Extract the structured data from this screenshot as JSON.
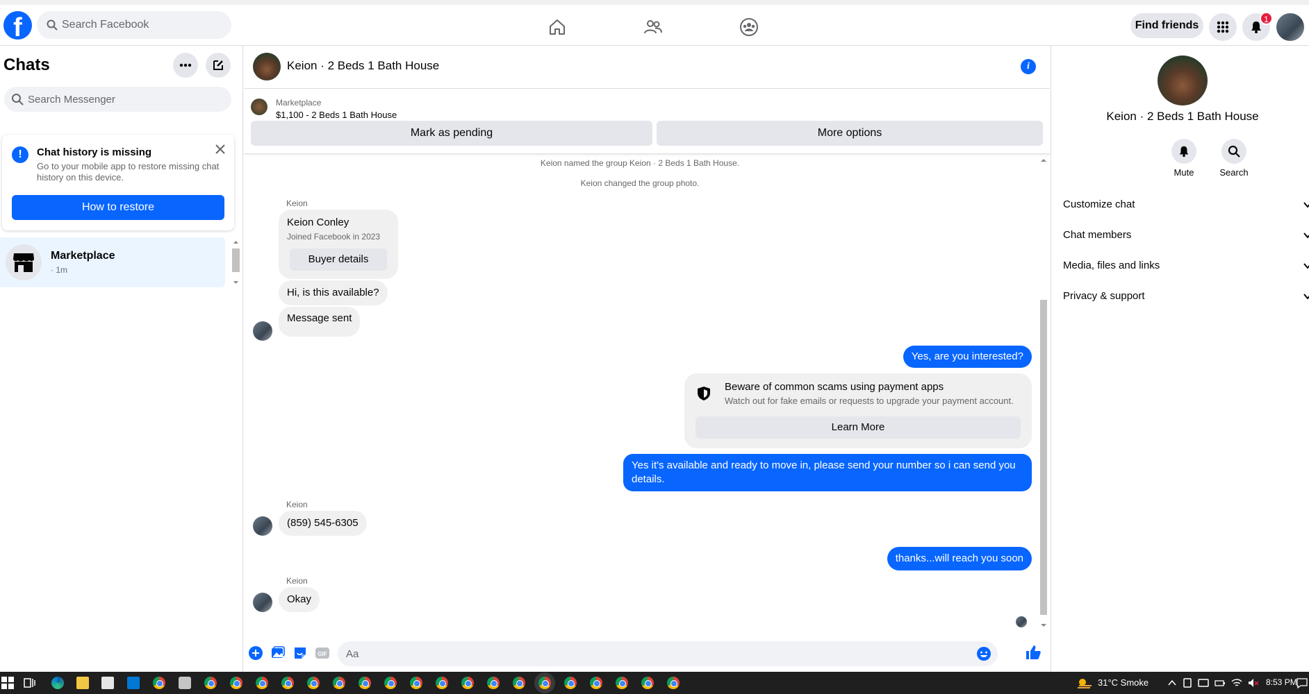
{
  "topbar": {
    "search_placeholder": "Search Facebook",
    "find_friends": "Find friends",
    "notification_count": "1"
  },
  "sidebar": {
    "title": "Chats",
    "search_placeholder": "Search Messenger",
    "notice": {
      "title": "Chat history is missing",
      "description": "Go to your mobile app to restore missing chat history on this device.",
      "button": "How to restore"
    },
    "chats": [
      {
        "name": "Marketplace",
        "time": "· 1m"
      }
    ]
  },
  "conversation": {
    "title": "Keion · 2 Beds 1 Bath House",
    "listing": {
      "category": "Marketplace",
      "price_title": "$1,100 - 2 Beds 1 Bath House",
      "pending_button": "Mark as pending",
      "options_button": "More options"
    },
    "system": [
      "Keion named the group Keion · 2 Beds 1 Bath House.",
      "Keion changed the group photo."
    ],
    "buyer_card": {
      "sender": "Keion",
      "name": "Keion Conley",
      "joined": "Joined Facebook in 2023",
      "button": "Buyer details"
    },
    "messages": {
      "m1": "Hi, is this available?",
      "m2": "Message sent",
      "m3": "Yes, are you interested?",
      "m4": "Yes it's available and ready to move in, please send your number so i can send you details.",
      "m5_sender": "Keion",
      "m5": "(859) 545-6305",
      "m6": "thanks...will reach you soon",
      "m7_sender": "Keion",
      "m7": "Okay"
    },
    "scam_card": {
      "title": "Beware of common scams using payment apps",
      "description": "Watch out for fake emails or requests to upgrade your payment account.",
      "button": "Learn More"
    },
    "composer_placeholder": "Aa"
  },
  "right_panel": {
    "name": "Keion · 2 Beds 1 Bath House",
    "actions": {
      "mute": "Mute",
      "search": "Search"
    },
    "sections": [
      "Customize chat",
      "Chat members",
      "Media, files and links",
      "Privacy & support"
    ]
  },
  "taskbar": {
    "weather": "31°C  Smoke",
    "time": "8:53 PM"
  },
  "colors": {
    "accent": "#0866ff",
    "bubble_in": "#f0f0f0",
    "badge": "#e41e3f"
  }
}
